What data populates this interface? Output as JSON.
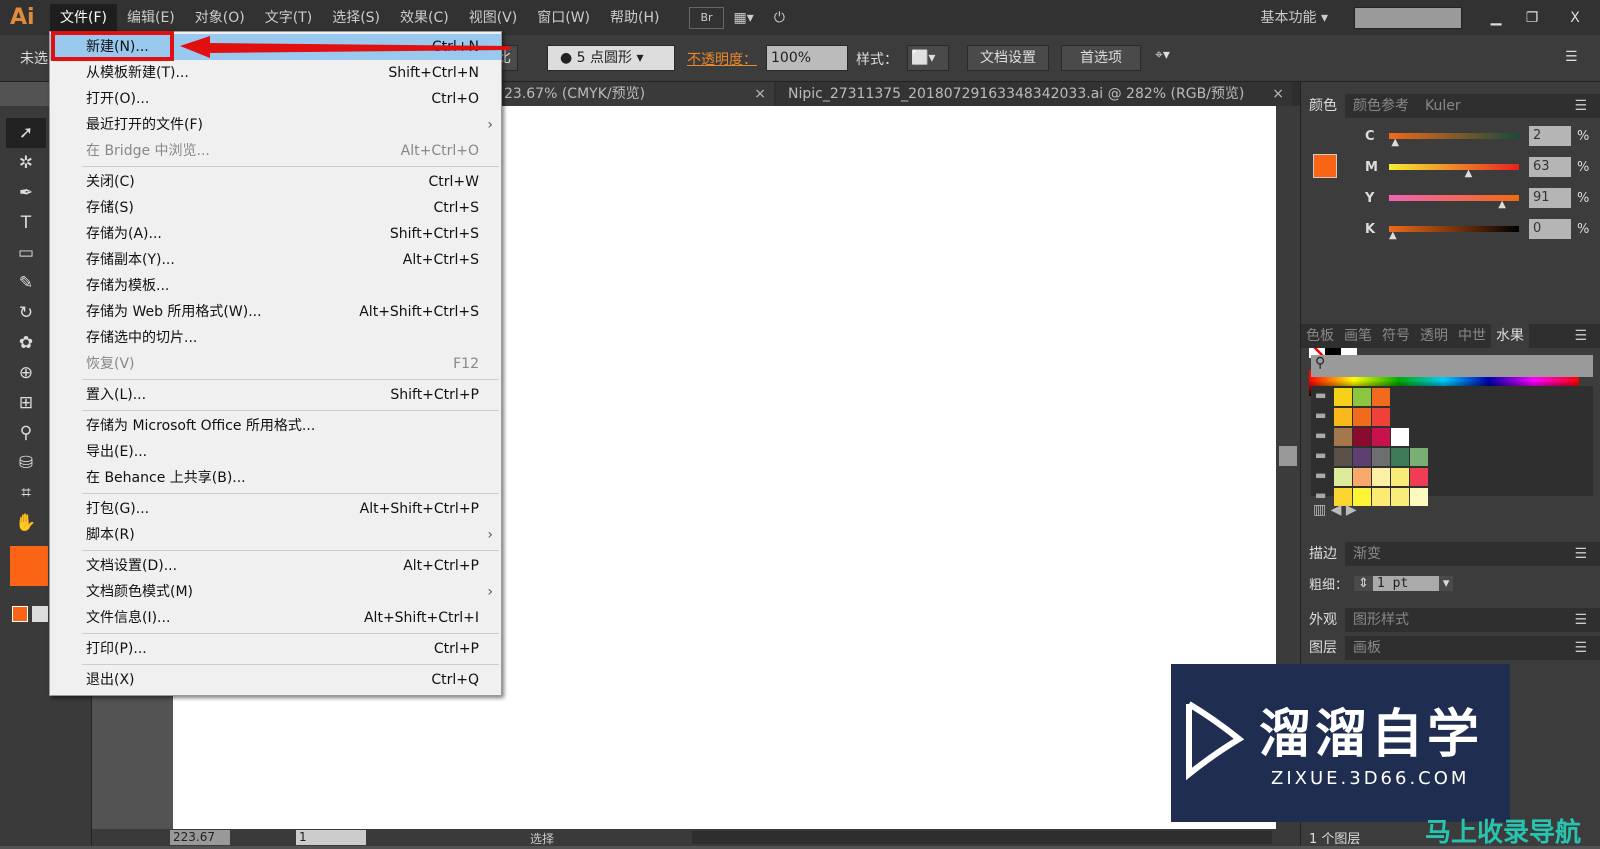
{
  "app": {
    "logo": "Ai"
  },
  "menubar": [
    "文件(F)",
    "编辑(E)",
    "对象(O)",
    "文字(T)",
    "选择(S)",
    "效果(C)",
    "视图(V)",
    "窗口(W)",
    "帮助(H)"
  ],
  "menubar_right": {
    "br": "Br",
    "workspace": "基本功能",
    "search_placeholder": ""
  },
  "control": {
    "selection": "未选",
    "stroke_profile_suffix": "比",
    "brush": "5 点圆形",
    "opacity_label": "不透明度：",
    "opacity": "100%",
    "style_label": "样式：",
    "doc_setup": "文档设置",
    "prefs": "首选项"
  },
  "tabs": [
    {
      "label": "23.67% (CMYK/预览)",
      "close": "×"
    },
    {
      "label": "Nipic_27311375_20180729163348342033.ai @ 282% (RGB/预览)",
      "close": "×"
    }
  ],
  "file_menu": [
    [
      {
        "label": "新建(N)...",
        "shortcut": "Ctrl+N",
        "highlight": true
      },
      {
        "label": "从模板新建(T)...",
        "shortcut": "Shift+Ctrl+N"
      },
      {
        "label": "打开(O)...",
        "shortcut": "Ctrl+O"
      },
      {
        "label": "最近打开的文件(F)",
        "shortcut": "",
        "submenu": true
      },
      {
        "label": "在 Bridge 中浏览...",
        "shortcut": "Alt+Ctrl+O",
        "disabled": true
      }
    ],
    [
      {
        "label": "关闭(C)",
        "shortcut": "Ctrl+W"
      },
      {
        "label": "存储(S)",
        "shortcut": "Ctrl+S"
      },
      {
        "label": "存储为(A)...",
        "shortcut": "Shift+Ctrl+S"
      },
      {
        "label": "存储副本(Y)...",
        "shortcut": "Alt+Ctrl+S"
      },
      {
        "label": "存储为模板...",
        "shortcut": ""
      },
      {
        "label": "存储为 Web 所用格式(W)...",
        "shortcut": "Alt+Shift+Ctrl+S"
      },
      {
        "label": "存储选中的切片...",
        "shortcut": ""
      },
      {
        "label": "恢复(V)",
        "shortcut": "F12",
        "disabled": true
      }
    ],
    [
      {
        "label": "置入(L)...",
        "shortcut": "Shift+Ctrl+P"
      }
    ],
    [
      {
        "label": "存储为 Microsoft Office 所用格式...",
        "shortcut": ""
      },
      {
        "label": "导出(E)...",
        "shortcut": ""
      },
      {
        "label": "在 Behance 上共享(B)...",
        "shortcut": ""
      }
    ],
    [
      {
        "label": "打包(G)...",
        "shortcut": "Alt+Shift+Ctrl+P"
      },
      {
        "label": "脚本(R)",
        "shortcut": "",
        "submenu": true
      }
    ],
    [
      {
        "label": "文档设置(D)...",
        "shortcut": "Alt+Ctrl+P"
      },
      {
        "label": "文档颜色模式(M)",
        "shortcut": "",
        "submenu": true
      },
      {
        "label": "文件信息(I)...",
        "shortcut": "Alt+Shift+Ctrl+I"
      }
    ],
    [
      {
        "label": "打印(P)...",
        "shortcut": "Ctrl+P"
      }
    ],
    [
      {
        "label": "退出(X)",
        "shortcut": "Ctrl+Q"
      }
    ]
  ],
  "color_panel": {
    "tabs": [
      "颜色",
      "颜色参考",
      "Kuler"
    ],
    "fill": "#fa6414",
    "channels": [
      {
        "name": "C",
        "value": "2",
        "pct": 2
      },
      {
        "name": "M",
        "value": "63",
        "pct": 63
      },
      {
        "name": "Y",
        "value": "91",
        "pct": 91
      },
      {
        "name": "K",
        "value": "0",
        "pct": 0
      }
    ],
    "unit": "%"
  },
  "swatch_panel": {
    "tabs": [
      "色板",
      "画笔",
      "符号",
      "透明",
      "中世",
      "水果"
    ],
    "rows": [
      [
        "#f7d117",
        "#8cc63f",
        "#f26b1d"
      ],
      [
        "#f9b81a",
        "#f26b1d",
        "#ef4138"
      ],
      [
        "#a4784b",
        "#8b0b2e",
        "#c7124c",
        "#ffffff"
      ],
      [
        "#5b514b",
        "#5e3f72",
        "#6d6e70",
        "#3d7a55",
        "#79ae75"
      ],
      [
        "#dcec9a",
        "#f9a86b",
        "#fdefa6",
        "#f6ec76",
        "#ef3d56"
      ],
      [
        "#fbd52f",
        "#fdf433",
        "#fdea74",
        "#f8ec7b",
        "#fdfac0"
      ]
    ]
  },
  "stroke_panel": {
    "tabs": [
      "描边",
      "渐变"
    ],
    "weight_label": "粗细：",
    "weight": "1 pt"
  },
  "appearance_panel": {
    "tabs": [
      "外观",
      "图形样式"
    ]
  },
  "layers_panel": {
    "tabs": [
      "图层",
      "画板"
    ],
    "count": "1 个图层"
  },
  "status": {
    "zoom": "223.67",
    "page": "1",
    "tool": "选择"
  },
  "watermark": {
    "name": "溜溜自学",
    "url": "ZIXUE.3D66.COM",
    "corner": "马上收录导航"
  }
}
